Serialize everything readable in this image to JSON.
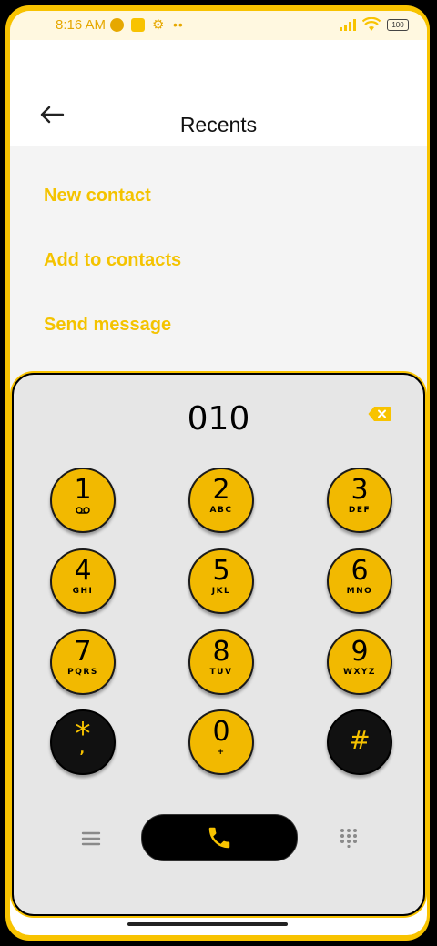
{
  "status_bar": {
    "time": "8:16 AM",
    "battery": "100",
    "icons": [
      "notification-icon",
      "app-square-icon",
      "gear-icon",
      "more-dots-icon",
      "signal-icon",
      "wifi-icon",
      "battery-icon"
    ]
  },
  "header": {
    "back_icon": "arrow-left-icon",
    "title": "Recents"
  },
  "options": [
    {
      "label": "New contact"
    },
    {
      "label": "Add to contacts"
    },
    {
      "label": "Send message"
    }
  ],
  "dialer": {
    "number": "010",
    "keys": [
      {
        "digit": "1",
        "letters": ""
      },
      {
        "digit": "2",
        "letters": "ABC"
      },
      {
        "digit": "3",
        "letters": "DEF"
      },
      {
        "digit": "4",
        "letters": "GHI"
      },
      {
        "digit": "5",
        "letters": "JKL"
      },
      {
        "digit": "6",
        "letters": "MNO"
      },
      {
        "digit": "7",
        "letters": "PQRS"
      },
      {
        "digit": "8",
        "letters": "TUV"
      },
      {
        "digit": "9",
        "letters": "WXYZ"
      },
      {
        "digit": "*",
        "letters": ","
      },
      {
        "digit": "0",
        "letters": "+"
      },
      {
        "digit": "#",
        "letters": ""
      }
    ]
  },
  "colors": {
    "accent": "#f8c300",
    "key_fill": "#f2b900",
    "panel_bg": "#e6e6e6",
    "text_dark": "#111111"
  }
}
